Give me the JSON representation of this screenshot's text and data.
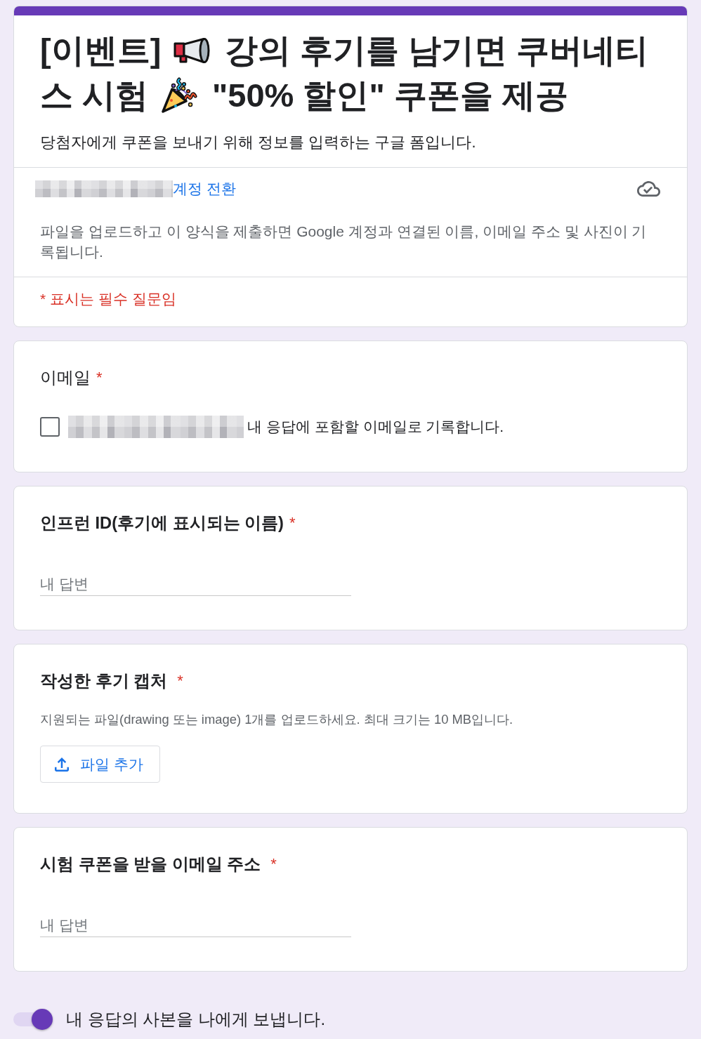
{
  "header": {
    "title_lines": [
      {
        "parts": [
          "[이벤트]",
          "강의 후기를 남기면 쿠버네티"
        ]
      },
      {
        "parts": [
          "스 시험",
          "\"50% 할인\" 쿠폰을 제공"
        ]
      }
    ],
    "description": "당첨자에게 쿠폰을 보내기 위해 정보를 입력하는 구글 폼입니다.",
    "switch_account_link": "계정 전환",
    "privacy_notice": "파일을 업로드하고 이 양식을 제출하면 Google 계정과 연결된 이름, 이메일 주소 및 사진이 기록됩니다.",
    "required_note": "* 표시는 필수 질문임"
  },
  "questions": [
    {
      "kind": "email",
      "title": "이메일",
      "required_mark": "*",
      "checkbox": {
        "label": "내 응답에 포함할 이메일로 기록합니다.",
        "checked": false
      }
    },
    {
      "kind": "text",
      "title": "인프런 ID(후기에 표시되는 이름)",
      "required_mark": "*",
      "placeholder": "내 답변"
    },
    {
      "kind": "file",
      "title": "작성한 후기 캡처",
      "required_mark": "*",
      "hint": "지원되는 파일(drawing 또는 image) 1개를 업로드하세요. 최대 크기는 10 MB입니다.",
      "button": "파일 추가"
    },
    {
      "kind": "text",
      "title": "시험 쿠폰을 받을 이메일 주소",
      "required_mark": "*",
      "placeholder": "내 답변"
    }
  ],
  "send_copy": {
    "label": "내 응답의 사본을 나에게 보냅니다.",
    "on": true
  }
}
